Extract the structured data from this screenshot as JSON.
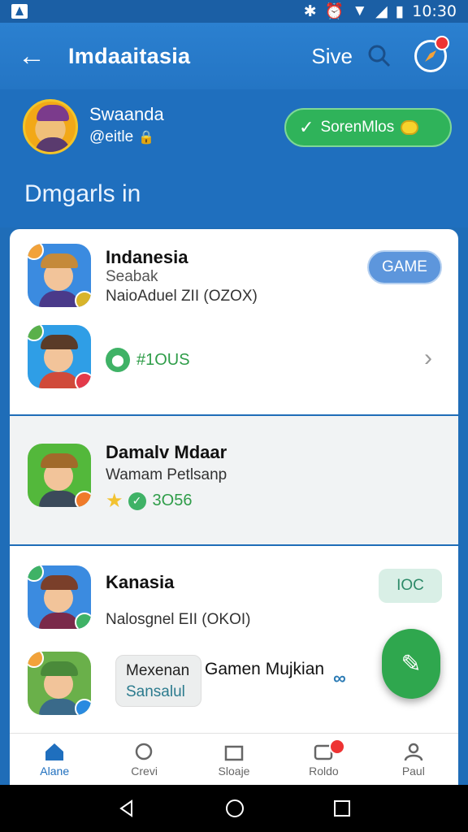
{
  "status": {
    "time": "10:30"
  },
  "appbar": {
    "title": "Imdaaitasia",
    "save_label": "Sive"
  },
  "profile": {
    "name": "Swaanda",
    "handle": "@eitle",
    "verify_label": "SorenMlos"
  },
  "section_title": "Dmgarls in",
  "games": [
    {
      "title": "Indanesia",
      "subtitle": "Seabak",
      "detail": "NaioAduel ZII (OZOX)",
      "pill": "GAME",
      "hat_color": "#c58a3a",
      "shirt_color": "#4a3a8a",
      "bg": "#3b8be0"
    },
    {
      "price": "#1OUS",
      "hat_color": "#5a3b28",
      "shirt_color": "#d04a3a",
      "bg": "#2f9ee6"
    },
    {
      "title": "Damalv Mdaar",
      "subtitle": "Wamam Petlsanp",
      "price": "3O56",
      "hat_color": "#a16a2a",
      "shirt_color": "#3b4a5a",
      "bg": "#53b83b"
    },
    {
      "title": "Kanasia",
      "detail": "Nalosgnel EII (OKOI)",
      "pill": "IOC",
      "hat_color": "#7a3f2a",
      "shirt_color": "#7a2a4a",
      "bg": "#3b8be0"
    },
    {
      "chip_line1": "Mexenan",
      "chip_line2": "Sansalul",
      "chip_text": "Gamen Mujkian",
      "hat_color": "#4a8a3a",
      "shirt_color": "#3a6a8a",
      "bg": "#6ab04a"
    }
  ],
  "nav": [
    {
      "label": "Alane",
      "icon": "home-icon"
    },
    {
      "label": "Crevi",
      "icon": "chat-icon"
    },
    {
      "label": "Sloaje",
      "icon": "store-icon"
    },
    {
      "label": "Roldo",
      "icon": "inbox-icon"
    },
    {
      "label": "Paul",
      "icon": "person-icon"
    }
  ]
}
